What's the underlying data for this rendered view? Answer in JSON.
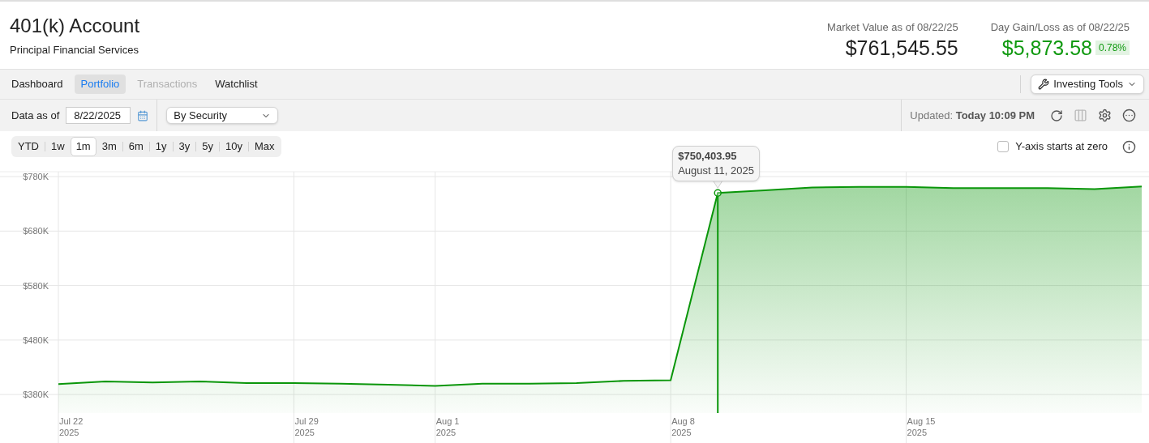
{
  "header": {
    "title": "401(k) Account",
    "subtitle": "Principal Financial Services",
    "stats": [
      {
        "kind": "plain",
        "label": "Market Value as of 08/22/25",
        "value": "$761,545.55"
      },
      {
        "kind": "gain",
        "label": "Day Gain/Loss as of 08/22/25",
        "value": "$5,873.58",
        "badge": "0.78%"
      }
    ]
  },
  "nav": {
    "tabs": [
      {
        "label": "Dashboard",
        "selected": false,
        "disabled": false
      },
      {
        "label": "Portfolio",
        "selected": true,
        "disabled": false
      },
      {
        "label": "Transactions",
        "selected": false,
        "disabled": true
      },
      {
        "label": "Watchlist",
        "selected": false,
        "disabled": false
      }
    ],
    "tools_button": "Investing Tools"
  },
  "toolbar": {
    "date_label": "Data as of",
    "date_value": "8/22/2025",
    "view_select": "By Security",
    "updated_label": "Updated:",
    "updated_value": "Today 10:09 PM"
  },
  "ranges": [
    {
      "label": "YTD",
      "selected": false
    },
    {
      "label": "1w",
      "selected": false
    },
    {
      "label": "1m",
      "selected": true
    },
    {
      "label": "3m",
      "selected": false
    },
    {
      "label": "6m",
      "selected": false
    },
    {
      "label": "1y",
      "selected": false
    },
    {
      "label": "3y",
      "selected": false
    },
    {
      "label": "5y",
      "selected": false
    },
    {
      "label": "10y",
      "selected": false
    },
    {
      "label": "Max",
      "selected": false
    }
  ],
  "y_axis_zero": {
    "label": "Y-axis starts at zero",
    "checked": false
  },
  "chart_data": {
    "type": "area",
    "categories": [
      "Jul 22\n2025",
      null,
      null,
      null,
      null,
      "Jul 29\n2025",
      null,
      null,
      "Aug 1\n2025",
      null,
      null,
      null,
      null,
      "Aug 8\n2025",
      null,
      null,
      null,
      null,
      "Aug 15\n2025",
      null,
      null,
      null,
      null,
      null
    ],
    "series": [
      {
        "color": "#0a960a",
        "values": [
          399000,
          404000,
          402000,
          404000,
          401000,
          401000,
          400000,
          398000,
          396000,
          400000,
          400000,
          401000,
          405000,
          406000,
          750000,
          755000,
          760000,
          761000,
          761000,
          759000,
          759000,
          759000,
          757000,
          762000
        ]
      }
    ],
    "ylim": [
      346000,
      789000
    ],
    "grid": true,
    "yticks": [
      {
        "value": 780000,
        "label": "$780K"
      },
      {
        "value": 680000,
        "label": "$680K"
      },
      {
        "value": 580000,
        "label": "$580K"
      },
      {
        "value": 480000,
        "label": "$480K"
      },
      {
        "value": 380000,
        "label": "$380K"
      }
    ],
    "annotations": [
      "$750,403.95"
    ]
  },
  "tooltip": {
    "date": "August 11, 2025"
  }
}
